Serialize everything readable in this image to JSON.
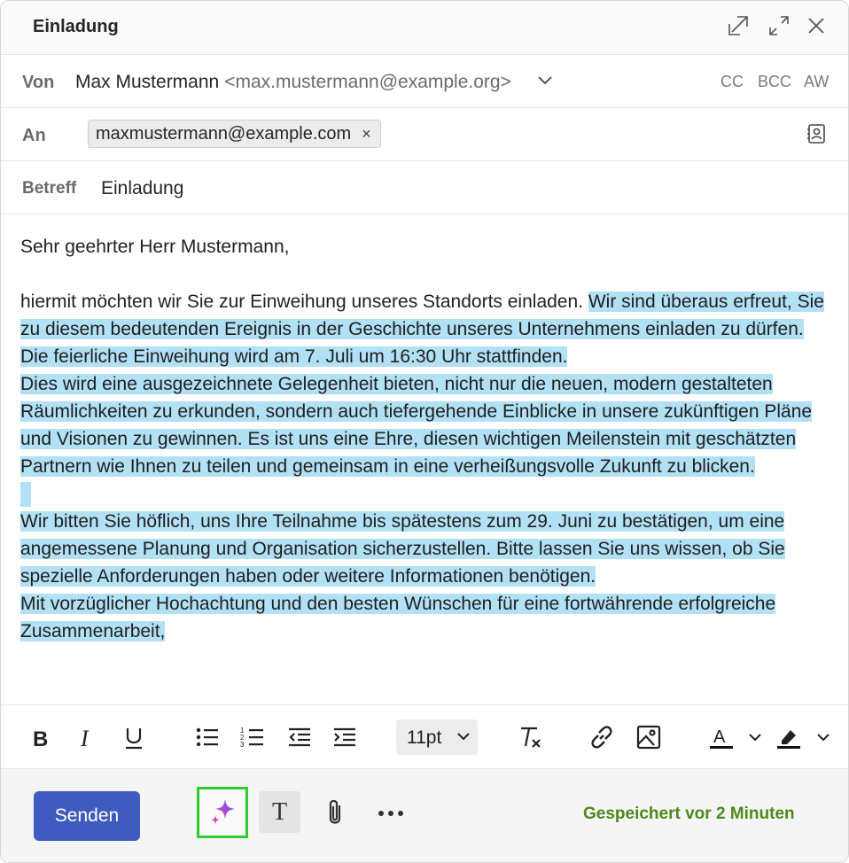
{
  "window": {
    "title": "Einladung"
  },
  "from": {
    "label": "Von",
    "name": "Max Mustermann",
    "email": "<max.mustermann@example.org>",
    "links": {
      "cc": "CC",
      "bcc": "BCC",
      "aw": "AW"
    }
  },
  "to": {
    "label": "An",
    "recipient": "maxmustermann@example.com",
    "remove_glyph": "×"
  },
  "subject": {
    "label": "Betreff",
    "value": "Einladung"
  },
  "message": {
    "greeting": "Sehr geehrter Herr Mustermann,",
    "p1_plain": "hiermit möchten wir Sie zur Einweihung unseres Standorts einladen. ",
    "p1_selected": "Wir sind überaus erfreut, Sie zu diesem bedeutenden Ereignis in der Geschichte unseres Unternehmens einladen zu dürfen. Die feierliche Einweihung wird am 7. Juli um 16:30 Uhr stattfinden.",
    "p2": "Dies wird eine ausgezeichnete Gelegenheit bieten, nicht nur die neuen, modern gestalteten Räumlichkeiten zu erkunden, sondern auch tiefergehende Einblicke in unsere zukünftigen Pläne und Visionen zu gewinnen. Es ist uns eine Ehre, diesen wichtigen Meilenstein mit geschätzten Partnern wie Ihnen zu teilen und gemeinsam in eine verheißungsvolle Zukunft zu blicken.",
    "p3": "Wir bitten Sie höflich, uns Ihre Teilnahme bis spätestens zum 29. Juni zu bestätigen, um eine angemessene Planung und Organisation sicherzustellen. Bitte lassen Sie uns wissen, ob Sie spezielle Anforderungen haben oder weitere Informationen benötigen.",
    "p4": "Mit vorzüglicher Hochachtung und den besten Wünschen für eine fortwährende erfolgreiche Zusammenarbeit,"
  },
  "format": {
    "font_size": "11pt"
  },
  "bottom": {
    "send_label": "Senden",
    "text_button_glyph": "T",
    "saved_status": "Gespeichert vor 2 Minuten"
  },
  "colors": {
    "accent": "#3f5bbf",
    "selection": "#b2e0f5",
    "saved_status": "#4a8a1a",
    "highlight_frame": "#2ecc2e"
  },
  "icons": [
    "pop-out-icon",
    "expand-icon",
    "close-icon",
    "chevron-down-icon",
    "contacts-icon",
    "bold-icon",
    "italic-icon",
    "underline-icon",
    "bullet-list-icon",
    "numbered-list-icon",
    "decrease-indent-icon",
    "increase-indent-icon",
    "clear-formatting-icon",
    "link-icon",
    "image-icon",
    "font-color-icon",
    "highlight-icon",
    "copilot-sparkle-icon",
    "paperclip-icon",
    "more-icon"
  ]
}
